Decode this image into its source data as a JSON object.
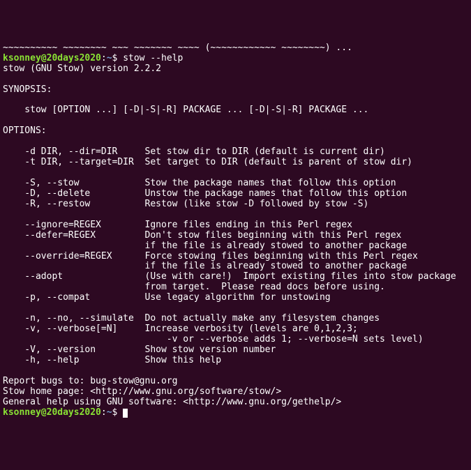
{
  "topFragment": "~~~~~~~~~~ ~~~~~~~~ ~~~ ~~~~~~~ ~~~~ (~~~~~~~~~~~~ ~~~~~~~~) ...",
  "prompt1": {
    "userhost": "ksonney@20days2020",
    "colon": ":",
    "path": "~",
    "dollar": "$ ",
    "command": "stow --help"
  },
  "output": [
    "stow (GNU Stow) version 2.2.2",
    "",
    "SYNOPSIS:",
    "",
    "    stow [OPTION ...] [-D|-S|-R] PACKAGE ... [-D|-S|-R] PACKAGE ...",
    "",
    "OPTIONS:",
    "",
    "    -d DIR, --dir=DIR     Set stow dir to DIR (default is current dir)",
    "    -t DIR, --target=DIR  Set target to DIR (default is parent of stow dir)",
    "",
    "    -S, --stow            Stow the package names that follow this option",
    "    -D, --delete          Unstow the package names that follow this option",
    "    -R, --restow          Restow (like stow -D followed by stow -S)",
    "",
    "    --ignore=REGEX        Ignore files ending in this Perl regex",
    "    --defer=REGEX         Don't stow files beginning with this Perl regex",
    "                          if the file is already stowed to another package",
    "    --override=REGEX      Force stowing files beginning with this Perl regex",
    "                          if the file is already stowed to another package",
    "    --adopt               (Use with care!)  Import existing files into stow package",
    "                          from target.  Please read docs before using.",
    "    -p, --compat          Use legacy algorithm for unstowing",
    "",
    "    -n, --no, --simulate  Do not actually make any filesystem changes",
    "    -v, --verbose[=N]     Increase verbosity (levels are 0,1,2,3;",
    "                              -v or --verbose adds 1; --verbose=N sets level)",
    "    -V, --version         Show stow version number",
    "    -h, --help            Show this help",
    "",
    "Report bugs to: bug-stow@gnu.org",
    "Stow home page: <http://www.gnu.org/software/stow/>",
    "General help using GNU software: <http://www.gnu.org/gethelp/>"
  ],
  "prompt2": {
    "userhost": "ksonney@20days2020",
    "colon": ":",
    "path": "~",
    "dollar": "$ "
  }
}
